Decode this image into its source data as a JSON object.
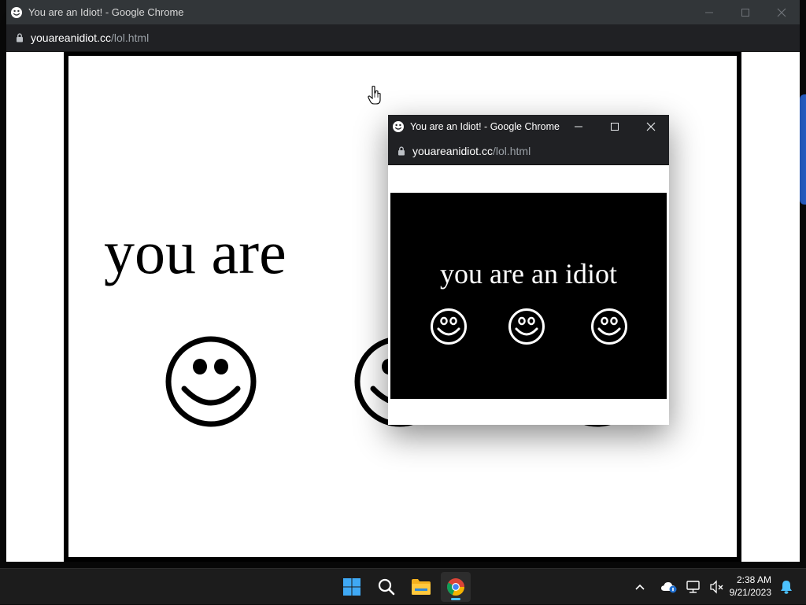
{
  "main_window": {
    "title": "You are an Idiot! - Google Chrome",
    "url_host": "youareanidiot.cc",
    "url_path": "/lol.html",
    "page_text": "you are"
  },
  "popup_window": {
    "title": "You are an Idiot! - Google Chrome",
    "url_host": "youareanidiot.cc",
    "url_path": "/lol.html",
    "page_text": "you are an idiot"
  },
  "taskbar": {
    "apps": [
      {
        "name": "windows-start",
        "icon": "windows-logo-icon"
      },
      {
        "name": "search",
        "icon": "search-icon"
      },
      {
        "name": "file-explorer",
        "icon": "folder-icon"
      },
      {
        "name": "google-chrome",
        "icon": "chrome-icon",
        "active": true
      }
    ],
    "tray_icons": [
      "chevron-up-icon",
      "onedrive-icon",
      "network-icon",
      "volume-muted-icon",
      "notification-bell-icon"
    ],
    "time": "2:38 AM",
    "date": "9/21/2023"
  },
  "colors": {
    "titlebar": "#323639",
    "popup_titlebar": "#202124",
    "addressbar": "#202124",
    "taskbar": "#1c1c1c",
    "chrome_accent": "#4cc2ff"
  }
}
